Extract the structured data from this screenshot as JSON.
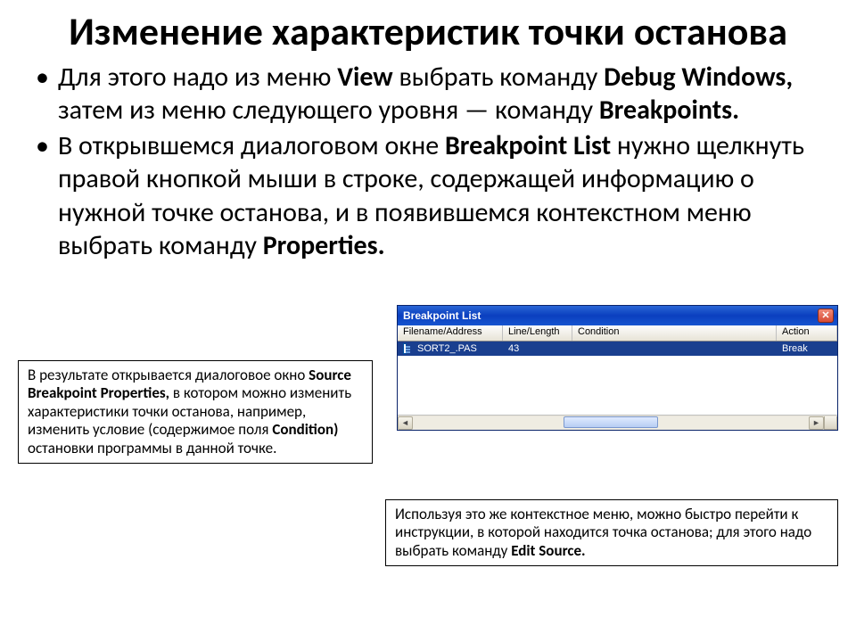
{
  "title": "Изменение характеристик точки останова",
  "bullets": [
    {
      "t1": "Для этого надо из меню ",
      "b1": "View",
      "t2": " выбрать команду ",
      "b2": "Debug Windows,",
      "t3": " затем из меню следующего уровня — команду ",
      "b3": "Breakpoints."
    },
    {
      "t1": "В открывшемся диалоговом окне ",
      "b1": "Breakpoint List",
      "t2": " нужно щелкнуть правой кнопкой мыши в строке, содержащей информацию о нужной точке останова, и в появившемся контекстном меню выбрать команду ",
      "b2": "Properties."
    }
  ],
  "bp_window": {
    "caption": "Breakpoint List",
    "close_glyph": "✕",
    "columns": {
      "fa": "Filename/Address",
      "ll": "Line/Length",
      "cond": "Condition",
      "act": "Action"
    },
    "row": {
      "file": "SORT2_.PAS",
      "line": "43",
      "cond": "",
      "action": "Break"
    },
    "scroll": {
      "left": "◄",
      "right": "►"
    }
  },
  "callout_left": {
    "t1": "В результате открывается диалоговое окно ",
    "b1": "Source Breakpoint Properties,",
    "t2": " в котором можно изменить характеристики точки останова, например, изменить условие (содержимое поля ",
    "b2": "Condition)",
    "t3": " остановки программы в данной точке."
  },
  "callout_right": {
    "t1": "Используя это же контекстное меню, можно быстро перейти к инструкции, в которой находится точка останова; для этого надо выбрать команду ",
    "b1": "Edit Source."
  }
}
